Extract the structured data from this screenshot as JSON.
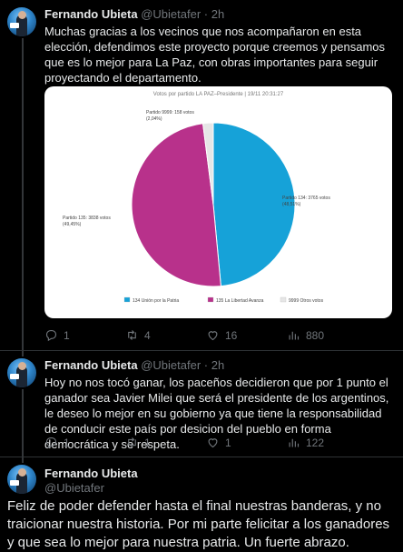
{
  "tweets": [
    {
      "author": "Fernando Ubieta",
      "handle": "@Ubietafer",
      "time": "2h",
      "text": "Muchas gracias a los vecinos que nos acompañaron en esta elección, defendimos este proyecto porque creemos y pensamos que es lo mejor para La Paz, con obras importantes para seguir proyectando el departamento.",
      "replies": "1",
      "retweets": "4",
      "likes": "16",
      "views": "880"
    },
    {
      "author": "Fernando Ubieta",
      "handle": "@Ubietafer",
      "time": "2h",
      "text": "Hoy no nos tocó ganar, los paceños decidieron que por 1 punto el ganador sea Javier Milei que será el presidente de los argentinos, le deseo lo mejor en su gobierno ya que tiene la responsabilidad de conducir este país por desicion del pueblo en forma democrática y se respeta.",
      "replies": "1",
      "retweets": "1",
      "likes": "1",
      "views": "122"
    },
    {
      "author": "Fernando Ubieta",
      "handle": "@Ubietafer",
      "text": "Feliz de poder defender hasta el final nuestras banderas, y no traicionar nuestra historia. Por mi parte felicitar a los ganadores y que sea lo mejor para nuestra patria. Un fuerte abrazo."
    }
  ],
  "chart_data": {
    "type": "pie",
    "title": "Votos por partido LA PAZ–Presidente | 19/11 20:31:27",
    "slices": [
      {
        "label": "Partido 134: 3765 votos",
        "pct_label": "(48,51%)",
        "legend": "134 Unión por la Patria",
        "value": 3765,
        "percent": 48.51,
        "color": "#16a2d8"
      },
      {
        "label": "Partido 135: 3838 votos",
        "pct_label": "(49,45%)",
        "legend": "135 La Libertad Avanza",
        "value": 3838,
        "percent": 49.45,
        "color": "#b8318b"
      },
      {
        "label": "Partido 9999: 158 votos",
        "pct_label": "(2,04%)",
        "legend": "9999 Otros votos",
        "value": 158,
        "percent": 2.04,
        "color": "#e6e6e6"
      }
    ]
  },
  "icons": [
    "reply-icon",
    "retweet-icon",
    "like-icon",
    "views-icon"
  ]
}
